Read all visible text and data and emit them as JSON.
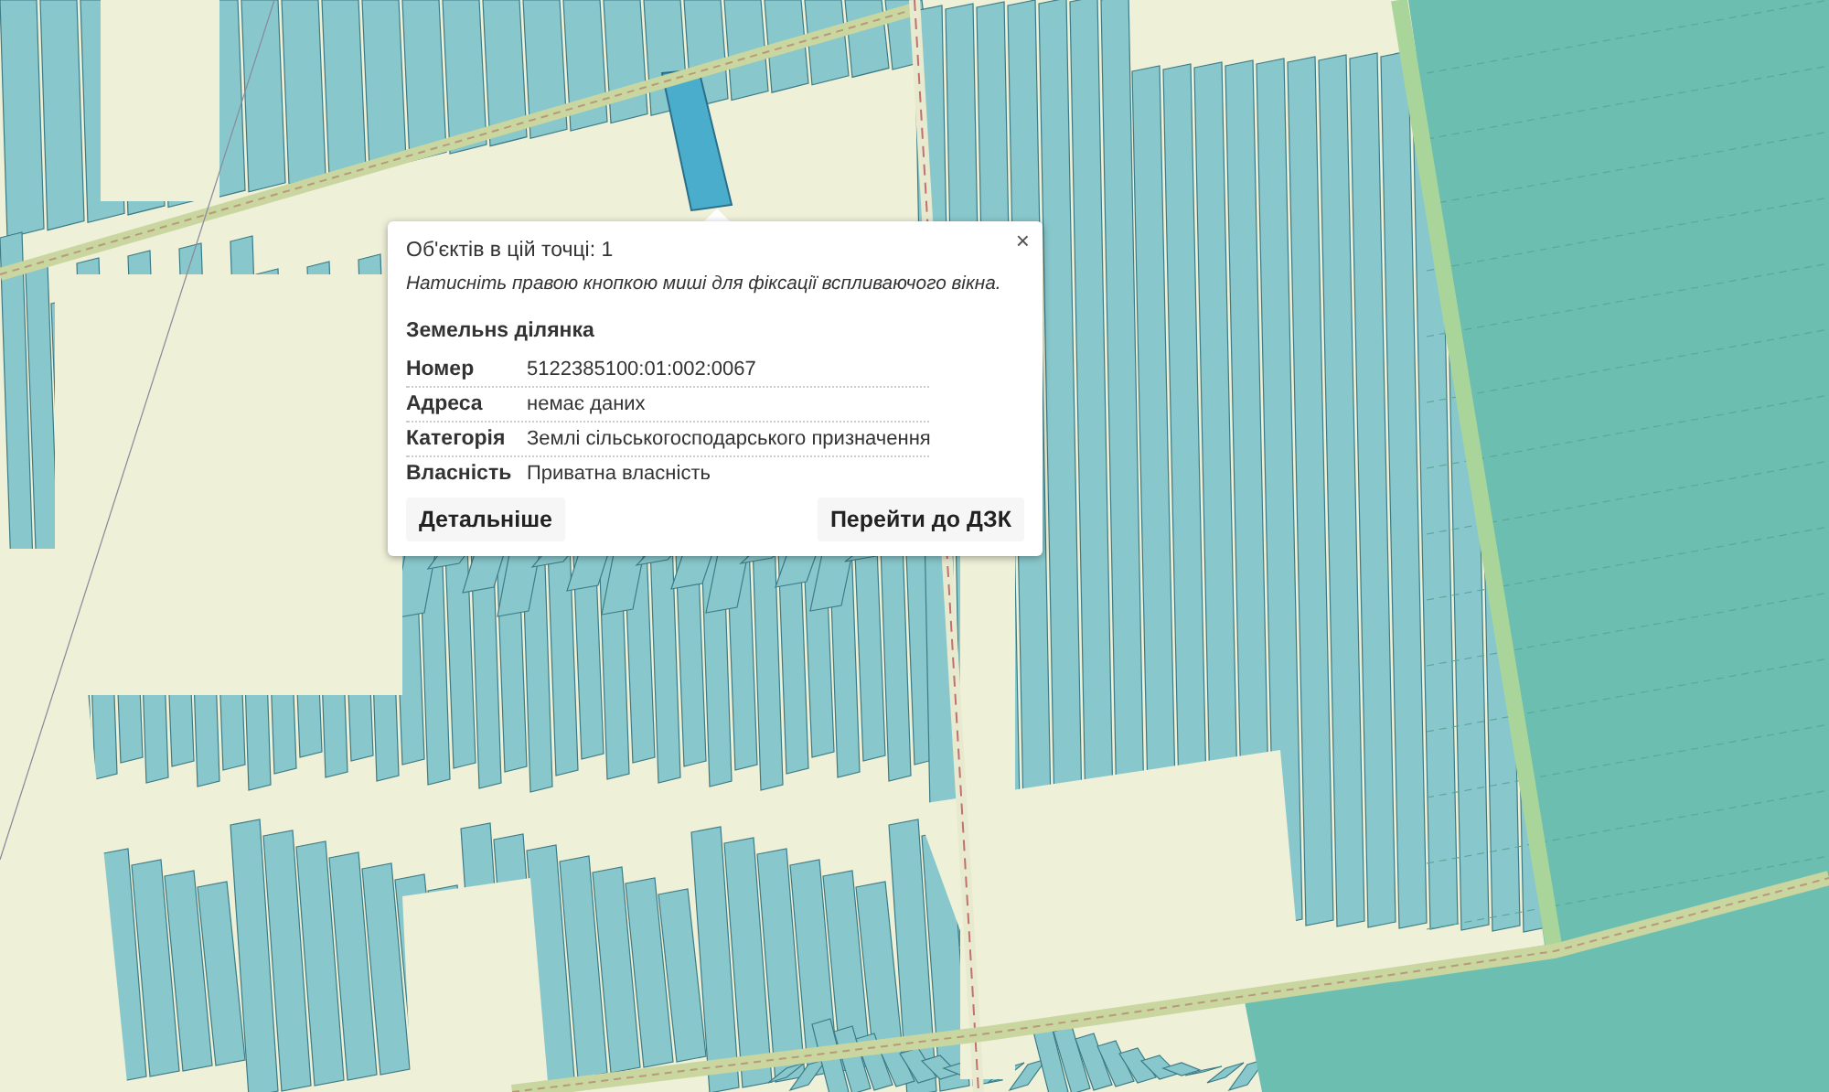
{
  "popup": {
    "count_text": "Об'єктів в цій точці: 1",
    "hint": "Натисніть правою кнопкою миші для фіксації вспливаючого вікна.",
    "close": "×",
    "title": "Земельнs ділянка",
    "rows": [
      {
        "label": "Номер",
        "value": "5122385100:01:002:0067"
      },
      {
        "label": "Адреса",
        "value": "немає даних"
      },
      {
        "label": "Категорія",
        "value": "Землі сільськогосподарського призначення"
      },
      {
        "label": "Власність",
        "value": "Приватна власність"
      }
    ],
    "buttons": [
      "Детальніше",
      "Перейти до ДЗК"
    ]
  }
}
